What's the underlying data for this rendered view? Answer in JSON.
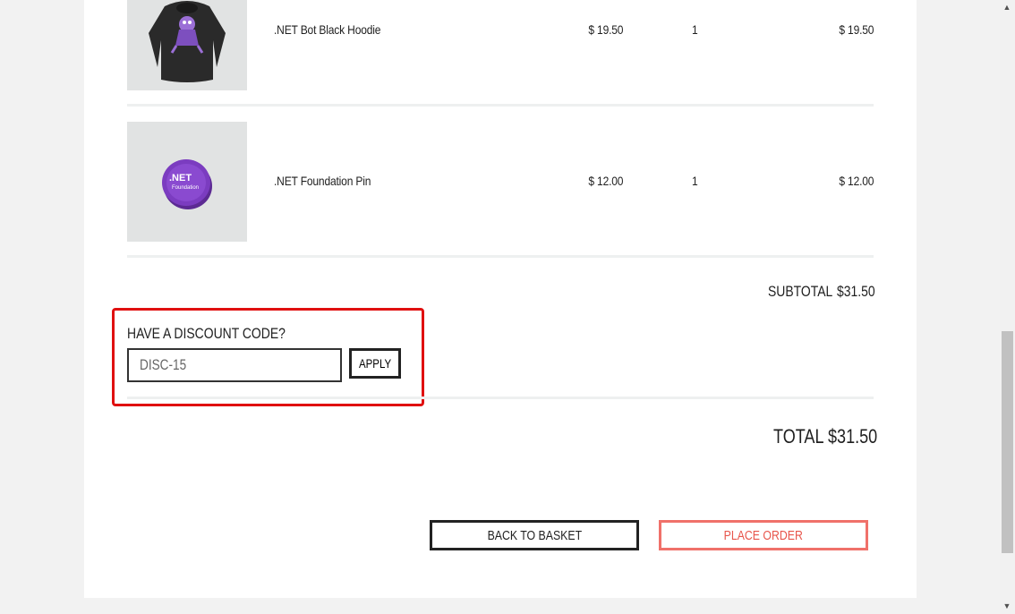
{
  "basket": {
    "items": [
      {
        "name": ".NET Bot Black Hoodie",
        "price": "$ 19.50",
        "quantity": "1",
        "total": "$ 19.50",
        "image_icon": "hoodie-image"
      },
      {
        "name": ".NET Foundation Pin",
        "price": "$ 12.00",
        "quantity": "1",
        "total": "$ 12.00",
        "image_icon": "pin-image"
      }
    ],
    "pin_text": {
      "net": ".NET",
      "foundation": "Foundation"
    }
  },
  "summary": {
    "subtotal_label": "SUBTOTAL",
    "subtotal_value": "$31.50",
    "total_label": "TOTAL",
    "total_value": "$31.50"
  },
  "discount": {
    "title": "HAVE A DISCOUNT CODE?",
    "input_value": "DISC-15",
    "apply_label": "APPLY",
    "highlight_color": "#e01010"
  },
  "actions": {
    "back_label": "BACK TO BASKET",
    "place_label": "PLACE ORDER",
    "place_color": "#e8564c"
  },
  "scrollbar": {
    "up_icon": "▲",
    "down_icon": "▼"
  }
}
